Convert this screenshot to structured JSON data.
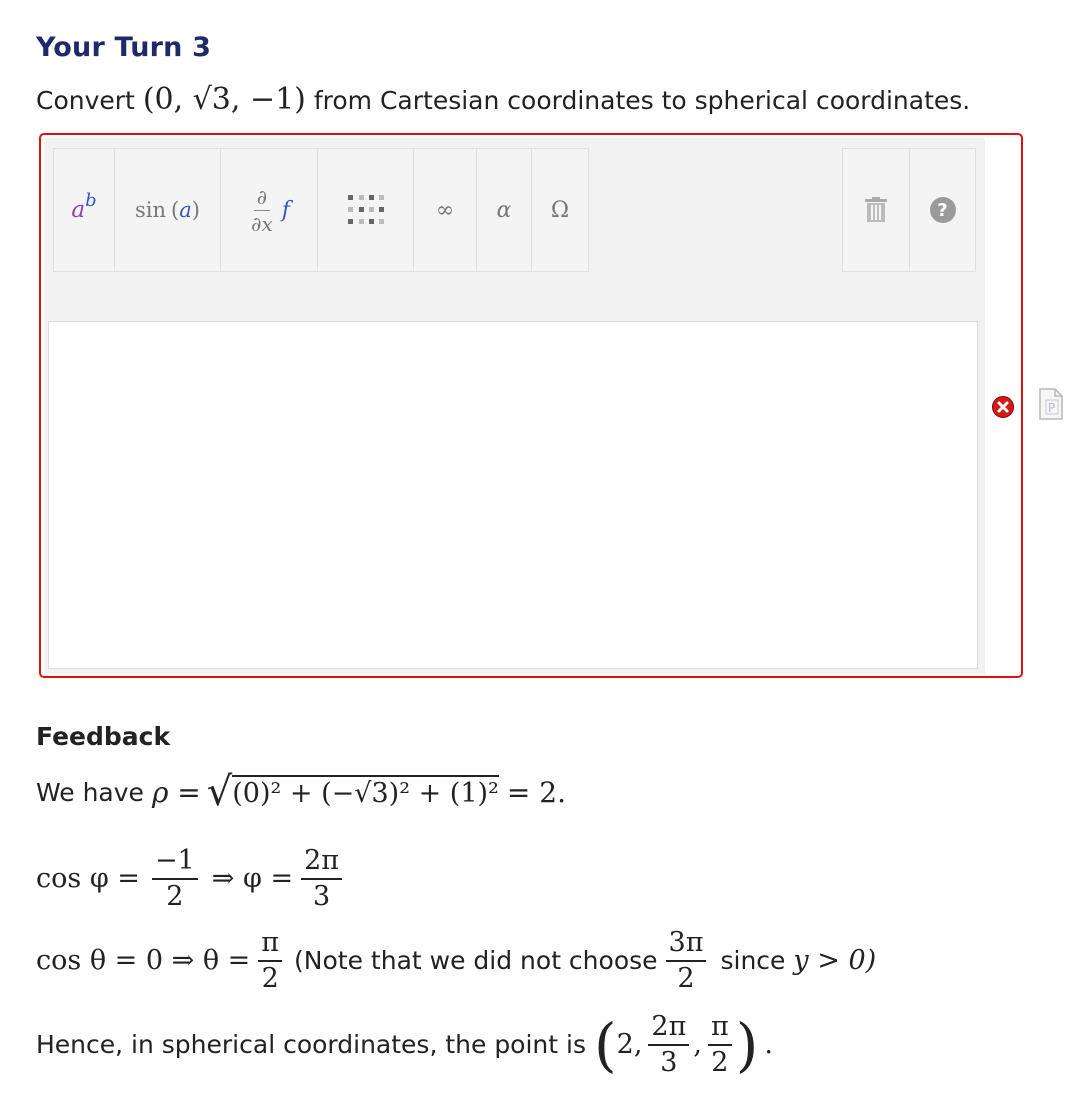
{
  "header": {
    "title": "Your Turn 3",
    "question_prefix": "Convert",
    "point": "(0, √3, −1)",
    "question_suffix": "from Cartesian coordinates to spherical coordinates."
  },
  "toolbar": {
    "buttons": [
      {
        "name": "superscript",
        "label": "a^b"
      },
      {
        "name": "trig",
        "label": "sin (a)"
      },
      {
        "name": "calculus",
        "label": "∂/∂x f"
      },
      {
        "name": "matrix",
        "label": "matrix"
      },
      {
        "name": "infinity",
        "label": "∞"
      },
      {
        "name": "greek-lower",
        "label": "α"
      },
      {
        "name": "greek-upper",
        "label": "Ω"
      },
      {
        "name": "trash",
        "label": "delete"
      },
      {
        "name": "help",
        "label": "?"
      }
    ],
    "sup_base": "a",
    "sup_exp": "b",
    "trig_fn": "sin",
    "trig_arg": "a",
    "deriv_num": "∂",
    "deriv_den": "∂x",
    "deriv_f": "f",
    "infinity": "∞",
    "alpha": "α",
    "omega": "Ω",
    "help": "?"
  },
  "input": {
    "value": "",
    "status": "incorrect"
  },
  "feedback": {
    "heading": "Feedback",
    "line1_prefix": "We have",
    "line1_rho": "ρ =",
    "line1_rad": "(0)² + (−√3)² + (1)²",
    "line1_result": "= 2.",
    "line2_lhs": "cos φ =",
    "line2_num": "−1",
    "line2_den": "2",
    "line2_mid": "⇒ φ =",
    "line2_num2": "2π",
    "line2_den2": "3",
    "line3_lhs": "cos θ = 0 ⇒ θ =",
    "line3_num": "π",
    "line3_den": "2",
    "line3_note": "(Note that we did not choose",
    "line3_num2": "3π",
    "line3_den2": "2",
    "line3_since": "since",
    "line3_cond": "y > 0)",
    "line4_prefix": "Hence, in spherical coordinates, the point is",
    "line4_a": "2,",
    "line4_num": "2π",
    "line4_den": "3",
    "line4_num2": "π",
    "line4_den2": "2",
    "line4_end": "."
  },
  "colors": {
    "title": "#1f2a6b",
    "error_border": "#e01010",
    "math_purple": "#8a3fb0",
    "math_blue": "#3a55c8"
  }
}
